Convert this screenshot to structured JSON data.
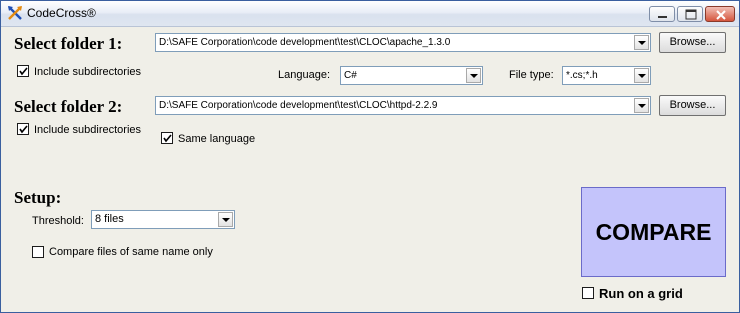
{
  "window": {
    "title": "CodeCross®",
    "icon": "crossed-arrows-app-icon",
    "controls": [
      "minimize-icon",
      "maximize-icon",
      "close-icon"
    ]
  },
  "folder1": {
    "heading": "Select folder 1:",
    "path": "D:\\SAFE Corporation\\code development\\test\\CLOC\\apache_1.3.0",
    "browse_label": "Browse...",
    "include_subdirs_label": "Include subdirectories",
    "include_subdirs_checked": true
  },
  "filters": {
    "language_label": "Language:",
    "language_value": "C#",
    "filetype_label": "File type:",
    "filetype_value": "*.cs;*.h"
  },
  "folder2": {
    "heading": "Select folder 2:",
    "path": "D:\\SAFE Corporation\\code development\\test\\CLOC\\httpd-2.2.9",
    "browse_label": "Browse...",
    "include_subdirs_label": "Include subdirectories",
    "include_subdirs_checked": true,
    "same_language_label": "Same language",
    "same_language_checked": true
  },
  "setup": {
    "heading": "Setup:",
    "threshold_label": "Threshold:",
    "threshold_value": "8 files",
    "same_name_label": "Compare files of same name only",
    "same_name_checked": false
  },
  "actions": {
    "compare_label": "COMPARE",
    "compare_color": "#c4c4fb",
    "grid_label": "Run on a grid",
    "grid_checked": false
  }
}
